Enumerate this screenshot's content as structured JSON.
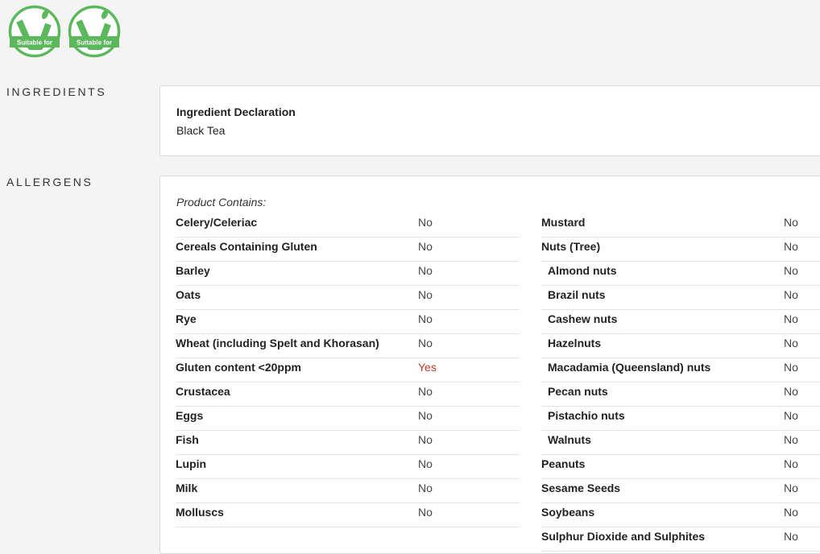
{
  "badges": [
    {
      "text": "Suitable for",
      "letter": "V",
      "color": "#5cb85c"
    },
    {
      "text": "Suitable for",
      "letter": "V",
      "color": "#5cb85c"
    }
  ],
  "ingredients": {
    "section_label": "INGREDIENTS",
    "declaration_title": "Ingredient Declaration",
    "declaration_value": "Black Tea"
  },
  "allergens": {
    "section_label": "ALLERGENS",
    "contains_label": "Product Contains:",
    "yes_color": "#c0392b",
    "left": [
      {
        "name": "Celery/Celeriac",
        "value": "No"
      },
      {
        "name": "Cereals Containing Gluten",
        "value": "No"
      },
      {
        "name": "Barley",
        "value": "No"
      },
      {
        "name": "Oats",
        "value": "No"
      },
      {
        "name": "Rye",
        "value": "No"
      },
      {
        "name": "Wheat (including Spelt and Khorasan)",
        "value": "No"
      },
      {
        "name": "Gluten content <20ppm",
        "value": "Yes"
      },
      {
        "name": "Crustacea",
        "value": "No"
      },
      {
        "name": "Eggs",
        "value": "No"
      },
      {
        "name": "Fish",
        "value": "No"
      },
      {
        "name": "Lupin",
        "value": "No"
      },
      {
        "name": "Milk",
        "value": "No"
      },
      {
        "name": "Molluscs",
        "value": "No"
      }
    ],
    "right": [
      {
        "name": "Mustard",
        "value": "No"
      },
      {
        "name": "Nuts (Tree)",
        "value": "No"
      },
      {
        "name": "Almond nuts",
        "value": "No"
      },
      {
        "name": "Brazil nuts",
        "value": "No"
      },
      {
        "name": "Cashew nuts",
        "value": "No"
      },
      {
        "name": "Hazelnuts",
        "value": "No"
      },
      {
        "name": "Macadamia (Queensland) nuts",
        "value": "No"
      },
      {
        "name": "Pecan nuts",
        "value": "No"
      },
      {
        "name": "Pistachio nuts",
        "value": "No"
      },
      {
        "name": "Walnuts",
        "value": "No"
      },
      {
        "name": "Peanuts",
        "value": "No"
      },
      {
        "name": "Sesame Seeds",
        "value": "No"
      },
      {
        "name": "Soybeans",
        "value": "No"
      },
      {
        "name": "Sulphur Dioxide and Sulphites",
        "value": "No"
      }
    ]
  }
}
